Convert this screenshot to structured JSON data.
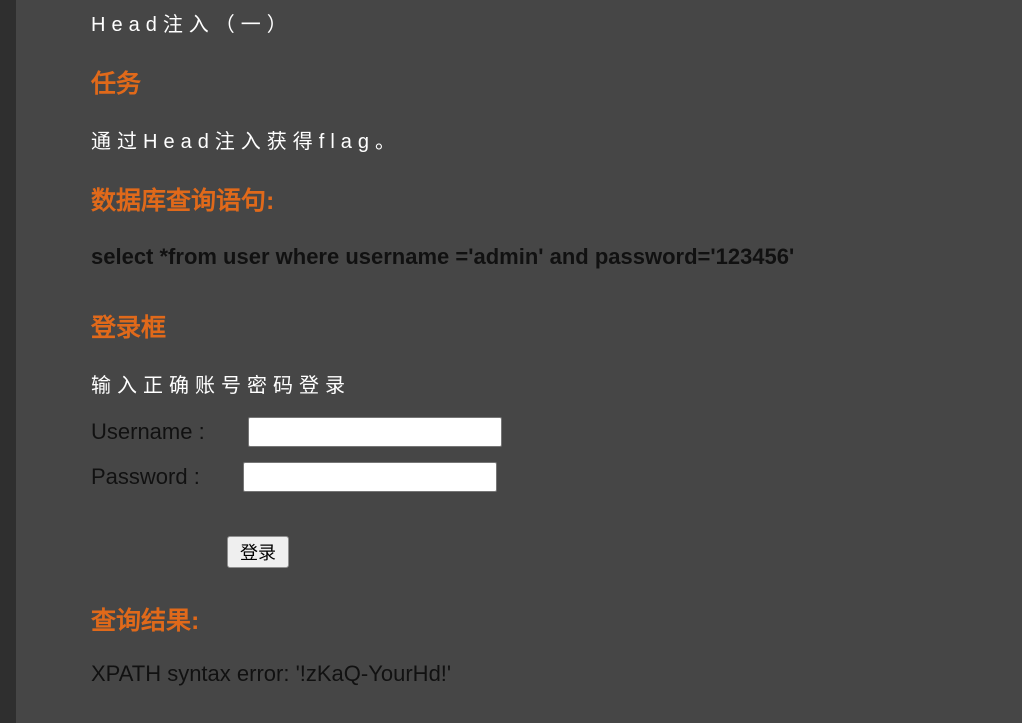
{
  "page": {
    "title": "Head注入（一）"
  },
  "task": {
    "heading": "任务",
    "description": "通过Head注入获得flag。"
  },
  "query": {
    "heading": "数据库查询语句:",
    "sql": "select *from user where username ='admin' and password='123456'"
  },
  "login": {
    "heading": "登录框",
    "hint": "输入正确账号密码登录",
    "username_label": "Username :",
    "username_value": "",
    "password_label": "Password :",
    "password_value": "",
    "submit_label": "登录"
  },
  "result": {
    "heading": "查询结果:",
    "message": "XPATH syntax error: '!zKaQ-YourHd!'"
  },
  "colors": {
    "background": "#464646",
    "heading": "#e0691a",
    "light_text": "#ffffff",
    "dark_text": "#111111"
  }
}
